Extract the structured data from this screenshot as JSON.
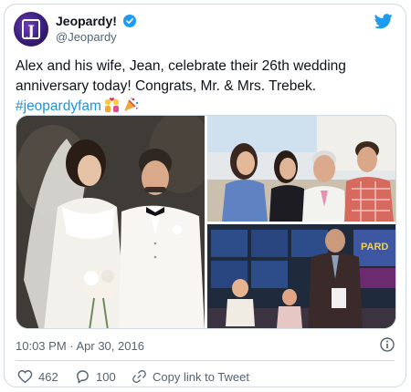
{
  "account": {
    "name": "Jeopardy!",
    "handle": "@Jeopardy",
    "verified": true
  },
  "tweet": {
    "line1": "Alex and his wife, Jean, celebrate their 26th wedding",
    "line2": "anniversary today! Congrats, Mr. & Mrs. Trebek.",
    "hashtag": "#jeopardyfam",
    "emojis": [
      "couple-with-heart",
      "party-popper"
    ]
  },
  "media": {
    "photo_count": 3
  },
  "meta": {
    "timestamp": "10:03 PM · Apr 30, 2016"
  },
  "actions": {
    "likes": "462",
    "replies": "100",
    "copy_link_label": "Copy link to Tweet"
  },
  "colors": {
    "accent": "#1d9bf0",
    "hashtag": "#1b95e0",
    "secondary_text": "#536471",
    "border": "#cfd9de"
  }
}
